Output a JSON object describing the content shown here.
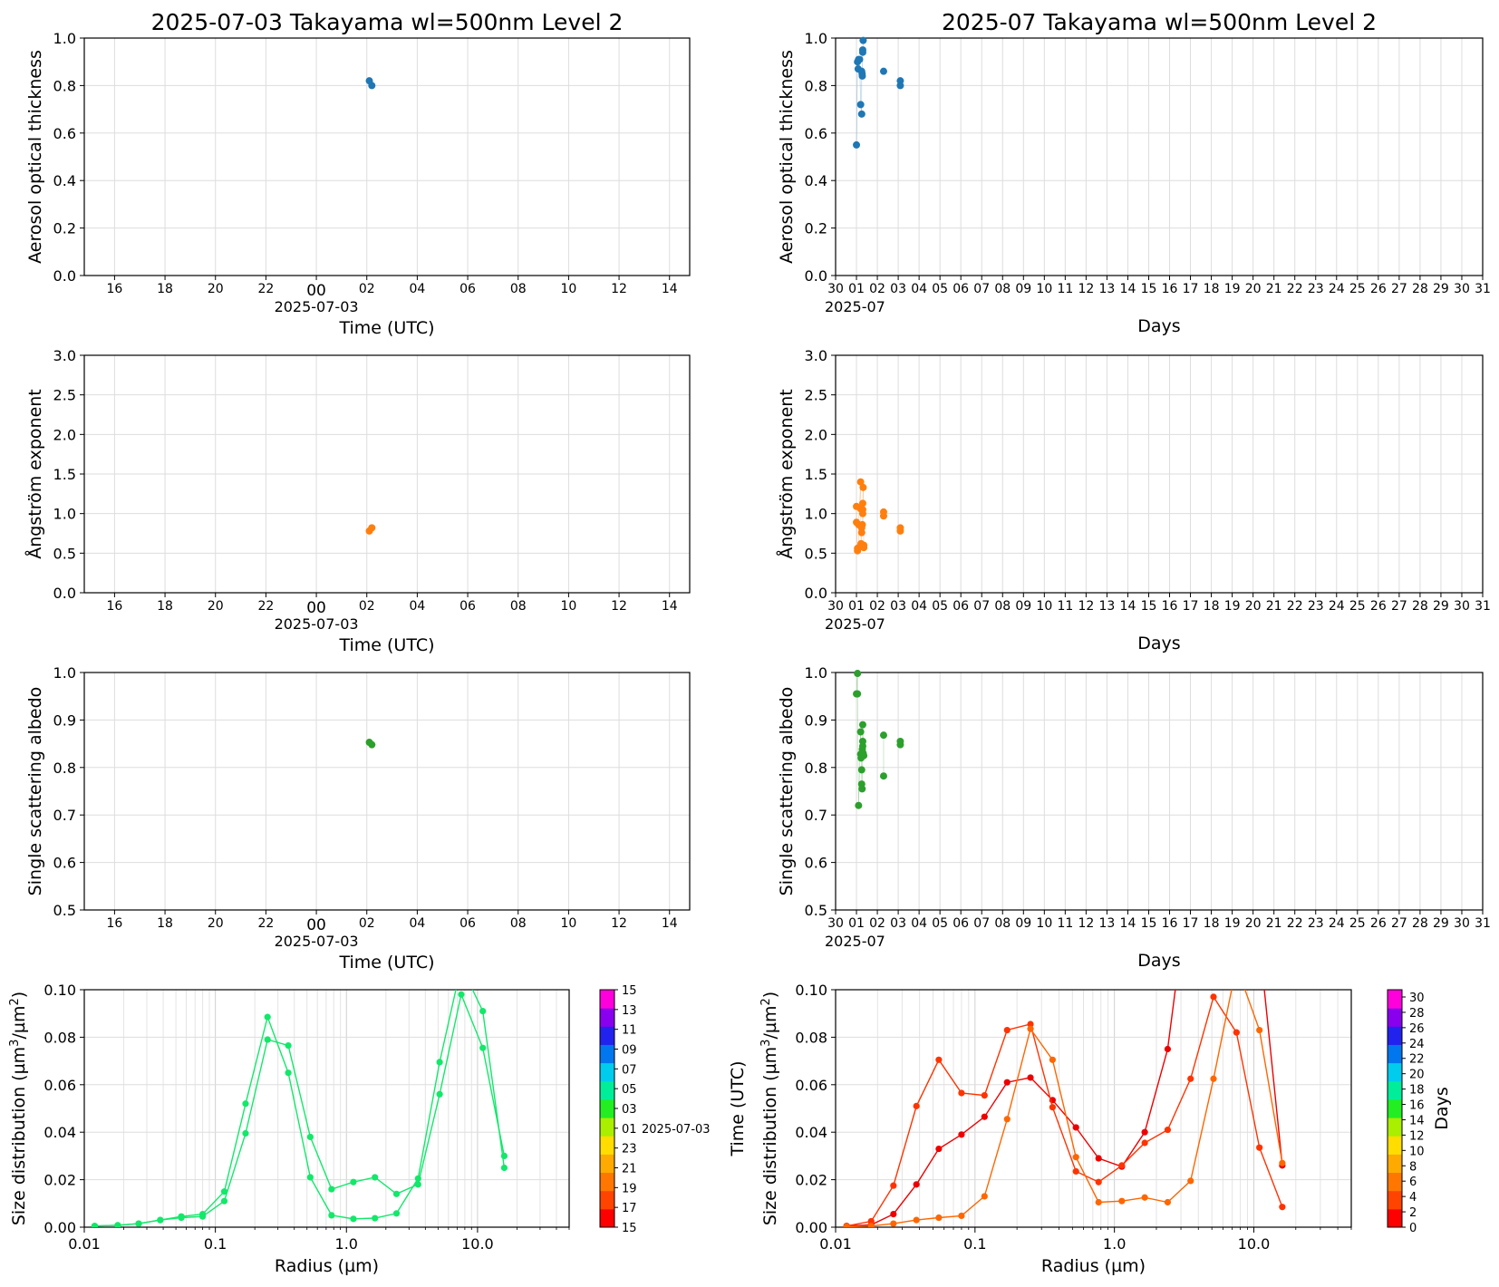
{
  "chart_data": [
    {
      "id": "aot_day",
      "type": "scatter",
      "title": "2025-07-03  Takayama  wl=500nm  Level 2",
      "xlabel": "Time (UTC)",
      "ylabel": "Aerosol optical thickness",
      "x_date_label": "2025-07-03",
      "x_range_hours": [
        -9.2,
        14.8
      ],
      "x_ticks": [
        "16",
        "18",
        "20",
        "22",
        "00",
        "02",
        "04",
        "06",
        "08",
        "10",
        "12",
        "14"
      ],
      "ylim": [
        0,
        1
      ],
      "y_ticks": [
        "0.0",
        "0.2",
        "0.4",
        "0.6",
        "0.8",
        "1.0"
      ],
      "grid": true,
      "color": "#1f77b4",
      "x_hours": [
        2.1,
        2.2
      ],
      "values": [
        0.82,
        0.8
      ]
    },
    {
      "id": "aot_month",
      "type": "scatter",
      "title": "2025-07  Takayama  wl=500nm  Level 2",
      "xlabel": "Days",
      "ylabel": "Aerosol optical thickness",
      "x_date_label": "2025-07",
      "x_range_days": [
        0,
        31
      ],
      "x_ticks": [
        "30",
        "01",
        "02",
        "03",
        "04",
        "05",
        "06",
        "07",
        "08",
        "09",
        "10",
        "11",
        "12",
        "13",
        "14",
        "15",
        "16",
        "17",
        "18",
        "19",
        "20",
        "21",
        "22",
        "23",
        "24",
        "25",
        "26",
        "27",
        "28",
        "29",
        "30",
        "31"
      ],
      "ylim": [
        0,
        1
      ],
      "y_ticks": [
        "0.0",
        "0.2",
        "0.4",
        "0.6",
        "0.8",
        "1.0"
      ],
      "grid": true,
      "color": "#1f77b4",
      "days": [
        1.0,
        1.05,
        1.08,
        1.1,
        1.15,
        1.2,
        1.25,
        1.25,
        1.27,
        1.28,
        1.3,
        1.3,
        1.32,
        2.3,
        3.1,
        3.1
      ],
      "values": [
        0.55,
        0.9,
        0.87,
        0.91,
        0.91,
        0.72,
        0.68,
        0.86,
        0.85,
        0.84,
        0.94,
        0.95,
        0.99,
        0.86,
        0.82,
        0.8
      ]
    },
    {
      "id": "ae_day",
      "type": "scatter",
      "title": "",
      "xlabel": "Time (UTC)",
      "ylabel": "Ångström exponent",
      "x_date_label": "2025-07-03",
      "x_range_hours": [
        -9.2,
        14.8
      ],
      "x_ticks": [
        "16",
        "18",
        "20",
        "22",
        "00",
        "02",
        "04",
        "06",
        "08",
        "10",
        "12",
        "14"
      ],
      "ylim": [
        0,
        3
      ],
      "y_ticks": [
        "0.0",
        "0.5",
        "1.0",
        "1.5",
        "2.0",
        "2.5",
        "3.0"
      ],
      "grid": true,
      "color": "#ff7f0e",
      "x_hours": [
        2.1,
        2.2
      ],
      "values": [
        0.78,
        0.82
      ]
    },
    {
      "id": "ae_month",
      "type": "scatter",
      "title": "",
      "xlabel": "Days",
      "ylabel": "Ångström exponent",
      "x_date_label": "2025-07",
      "x_range_days": [
        0,
        31
      ],
      "x_ticks": [
        "30",
        "01",
        "02",
        "03",
        "04",
        "05",
        "06",
        "07",
        "08",
        "09",
        "10",
        "11",
        "12",
        "13",
        "14",
        "15",
        "16",
        "17",
        "18",
        "19",
        "20",
        "21",
        "22",
        "23",
        "24",
        "25",
        "26",
        "27",
        "28",
        "29",
        "30",
        "31"
      ],
      "ylim": [
        0,
        3
      ],
      "y_ticks": [
        "0.0",
        "0.5",
        "1.0",
        "1.5",
        "2.0",
        "2.5",
        "3.0"
      ],
      "grid": true,
      "color": "#ff7f0e",
      "days": [
        1.0,
        1.0,
        1.05,
        1.05,
        1.1,
        1.1,
        1.2,
        1.2,
        1.22,
        1.25,
        1.25,
        1.28,
        1.3,
        1.3,
        1.3,
        1.32,
        1.35,
        1.35,
        2.3,
        2.3,
        3.1,
        3.1
      ],
      "values": [
        1.09,
        0.89,
        0.53,
        0.56,
        0.57,
        0.86,
        1.4,
        1.06,
        0.62,
        0.76,
        0.82,
        0.86,
        1.0,
        1.05,
        1.13,
        1.33,
        0.57,
        0.6,
        0.97,
        1.02,
        0.78,
        0.82
      ]
    },
    {
      "id": "ssa_day",
      "type": "scatter",
      "title": "",
      "xlabel": "Time (UTC)",
      "ylabel": "Single scattering albedo",
      "x_date_label": "2025-07-03",
      "x_range_hours": [
        -9.2,
        14.8
      ],
      "x_ticks": [
        "16",
        "18",
        "20",
        "22",
        "00",
        "02",
        "04",
        "06",
        "08",
        "10",
        "12",
        "14"
      ],
      "ylim": [
        0.5,
        1.0
      ],
      "y_ticks": [
        "0.5",
        "0.6",
        "0.7",
        "0.8",
        "0.9",
        "1.0"
      ],
      "grid": true,
      "color": "#2ca02c",
      "x_hours": [
        2.1,
        2.2
      ],
      "values": [
        0.853,
        0.848
      ]
    },
    {
      "id": "ssa_month",
      "type": "scatter",
      "title": "",
      "xlabel": "Days",
      "ylabel": "Single scattering albedo",
      "x_date_label": "2025-07",
      "x_range_days": [
        0,
        31
      ],
      "x_ticks": [
        "30",
        "01",
        "02",
        "03",
        "04",
        "05",
        "06",
        "07",
        "08",
        "09",
        "10",
        "11",
        "12",
        "13",
        "14",
        "15",
        "16",
        "17",
        "18",
        "19",
        "20",
        "21",
        "22",
        "23",
        "24",
        "25",
        "26",
        "27",
        "28",
        "29",
        "30",
        "31"
      ],
      "ylim": [
        0.5,
        1.0
      ],
      "y_ticks": [
        "0.5",
        "0.6",
        "0.7",
        "0.8",
        "0.9",
        "1.0"
      ],
      "grid": true,
      "color": "#2ca02c",
      "days": [
        1.0,
        1.05,
        1.05,
        1.1,
        1.2,
        1.2,
        1.22,
        1.25,
        1.25,
        1.27,
        1.28,
        1.3,
        1.3,
        1.3,
        1.32,
        1.35,
        2.3,
        2.3,
        3.1,
        3.1
      ],
      "values": [
        0.955,
        0.998,
        0.955,
        0.72,
        0.875,
        0.828,
        0.82,
        0.795,
        0.765,
        0.755,
        0.838,
        0.845,
        0.855,
        0.89,
        0.83,
        0.825,
        0.868,
        0.782,
        0.855,
        0.848
      ]
    },
    {
      "id": "sd_day",
      "type": "line",
      "xscale": "log",
      "xlabel": "Radius (µm)",
      "ylabel_main": "Size distribution (µm",
      "ylabel_sup1": "3",
      "ylabel_mid": "/µm",
      "ylabel_sup2": "2",
      "ylabel_end": ")",
      "xlim": [
        0.01,
        50
      ],
      "ylim": [
        0,
        0.1
      ],
      "x_ticks": [
        "0.01",
        "0.1",
        "1.0",
        "10.0"
      ],
      "y_ticks": [
        "0.00",
        "0.02",
        "0.04",
        "0.06",
        "0.08",
        "0.10"
      ],
      "grid": true,
      "radii": [
        0.012,
        0.018,
        0.026,
        0.038,
        0.055,
        0.08,
        0.117,
        0.17,
        0.25,
        0.36,
        0.53,
        0.77,
        1.13,
        1.65,
        2.41,
        3.52,
        5.14,
        7.51,
        10.97,
        16.0
      ],
      "series": [
        {
          "color": "#12e86a",
          "values": [
            0.0005,
            0.0008,
            0.0015,
            0.003,
            0.0045,
            0.0055,
            0.015,
            0.052,
            0.0885,
            0.065,
            0.021,
            0.005,
            0.0035,
            0.0038,
            0.0058,
            0.0205,
            0.0695,
            0.11,
            0.091,
            0.025
          ]
        },
        {
          "color": "#12e86a",
          "values": [
            0.0005,
            0.0008,
            0.0015,
            0.003,
            0.004,
            0.0045,
            0.011,
            0.0395,
            0.079,
            0.0765,
            0.038,
            0.016,
            0.019,
            0.021,
            0.014,
            0.018,
            0.056,
            0.098,
            0.0755,
            0.03
          ]
        }
      ],
      "colorbar": {
        "label": "Time (UTC)",
        "date_label": "2025-07-03",
        "ticks": [
          "15",
          "17",
          "19",
          "21",
          "23",
          "01",
          "03",
          "05",
          "07",
          "09",
          "11",
          "13",
          "15"
        ],
        "colors": [
          "#ff0000",
          "#ff4400",
          "#ff7700",
          "#ffaa00",
          "#ffdd00",
          "#aaee00",
          "#22ee22",
          "#00ee99",
          "#00ccee",
          "#0077ee",
          "#2222ee",
          "#8800ee",
          "#ff00dd"
        ]
      }
    },
    {
      "id": "sd_month",
      "type": "line",
      "xscale": "log",
      "xlabel": "Radius (µm)",
      "ylabel_main": "Size distribution (µm",
      "ylabel_sup1": "3",
      "ylabel_mid": "/µm",
      "ylabel_sup2": "2",
      "ylabel_end": ")",
      "xlim": [
        0.01,
        50
      ],
      "ylim": [
        0,
        0.1
      ],
      "x_ticks": [
        "0.01",
        "0.1",
        "1.0",
        "10.0"
      ],
      "y_ticks": [
        "0.00",
        "0.02",
        "0.04",
        "0.06",
        "0.08",
        "0.10"
      ],
      "grid": true,
      "radii": [
        0.012,
        0.018,
        0.026,
        0.038,
        0.055,
        0.08,
        0.117,
        0.17,
        0.25,
        0.36,
        0.53,
        0.77,
        1.13,
        1.65,
        2.41,
        3.52,
        5.14,
        7.51,
        10.97,
        16.0
      ],
      "series": [
        {
          "color": "#ee0000",
          "values": [
            0.0005,
            0.001,
            0.0055,
            0.018,
            0.033,
            0.039,
            0.0465,
            0.061,
            0.063,
            0.0535,
            0.042,
            0.029,
            0.0255,
            0.04,
            0.075,
            0.15,
            0.2,
            0.17,
            0.12,
            0.026
          ]
        },
        {
          "color": "#ff3300",
          "values": [
            0.0005,
            0.0025,
            0.0175,
            0.051,
            0.0705,
            0.0565,
            0.0555,
            0.083,
            0.0855,
            0.0505,
            0.0235,
            0.019,
            0.026,
            0.0355,
            0.041,
            0.0625,
            0.097,
            0.082,
            0.0335,
            0.0085
          ]
        },
        {
          "color": "#ff6600",
          "values": [
            0.0002,
            0.0005,
            0.0015,
            0.003,
            0.004,
            0.0048,
            0.013,
            0.0455,
            0.0835,
            0.0705,
            0.0295,
            0.0105,
            0.011,
            0.0125,
            0.0105,
            0.0195,
            0.0625,
            0.11,
            0.083,
            0.027
          ]
        }
      ],
      "colorbar": {
        "label": "Days",
        "ticks": [
          "0",
          "2",
          "4",
          "6",
          "8",
          "10",
          "12",
          "14",
          "16",
          "18",
          "20",
          "22",
          "24",
          "26",
          "28",
          "30"
        ],
        "colors": [
          "#ff0000",
          "#ff4400",
          "#ff7700",
          "#ffaa00",
          "#ffdd00",
          "#aaee00",
          "#22ee22",
          "#00ee99",
          "#00ccee",
          "#0077ee",
          "#2222ee",
          "#8800ee",
          "#ff00dd"
        ]
      }
    }
  ]
}
